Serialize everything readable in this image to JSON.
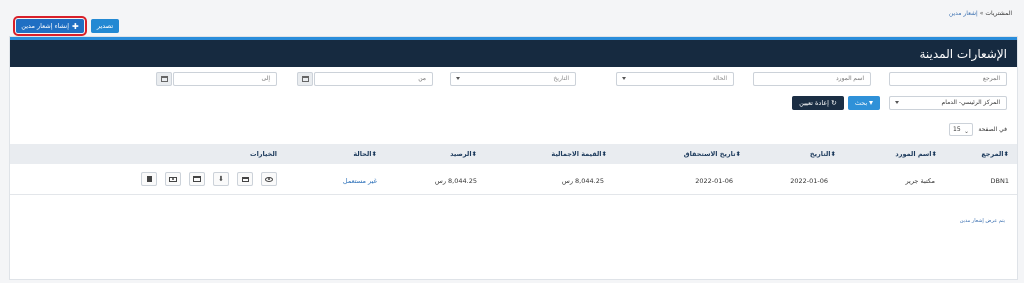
{
  "breadcrumb": {
    "root": "المشتريات",
    "separator": "»",
    "current": "إشعار مدين"
  },
  "toolbar": {
    "create_label": "إنشاء إشعار مدين",
    "export_label": "تصدير"
  },
  "panel": {
    "title": "الإشعارات المدينة"
  },
  "filters": {
    "reference_placeholder": "المرجع",
    "supplier_placeholder": "اسم المورد",
    "status_placeholder": "الحالة",
    "date_placeholder": "التاريخ",
    "from_placeholder": "من",
    "to_placeholder": "إلى",
    "branch_value": "المركز الرئيسي- الدمام",
    "search_label": "بحث",
    "reset_label": "إعادة تعيين"
  },
  "pagination": {
    "per_page_label": "في الصفحة",
    "per_page_value": "15"
  },
  "table": {
    "columns": [
      "المرجع",
      "اسم المورد",
      "التاريخ",
      "تاريخ الاستحقاق",
      "القيمة الاجمالية",
      "الرصيد",
      "الحالة",
      "الخيارات"
    ],
    "rows": [
      {
        "reference": "DBN1",
        "supplier": "مكتبة جرير",
        "date": "2022-01-06",
        "due_date": "2022-01-06",
        "total": "8,044.25 رس",
        "balance": "8,044.25 رس",
        "status": "غير مستعمل"
      }
    ]
  },
  "footer": {
    "note": "يتم عرض إشعار مدين"
  },
  "colors": {
    "header_bg": "#162a40",
    "accent": "#2a8ddb",
    "create_button": "#1f6fc3",
    "highlight_outline": "#d8202a"
  },
  "icons": [
    "plus-icon",
    "filter-icon",
    "reset-icon",
    "calendar-icon",
    "chevron-down-icon",
    "sort-icon",
    "eye-icon",
    "print-icon",
    "download-icon",
    "card-icon",
    "money-icon",
    "trash-icon"
  ]
}
